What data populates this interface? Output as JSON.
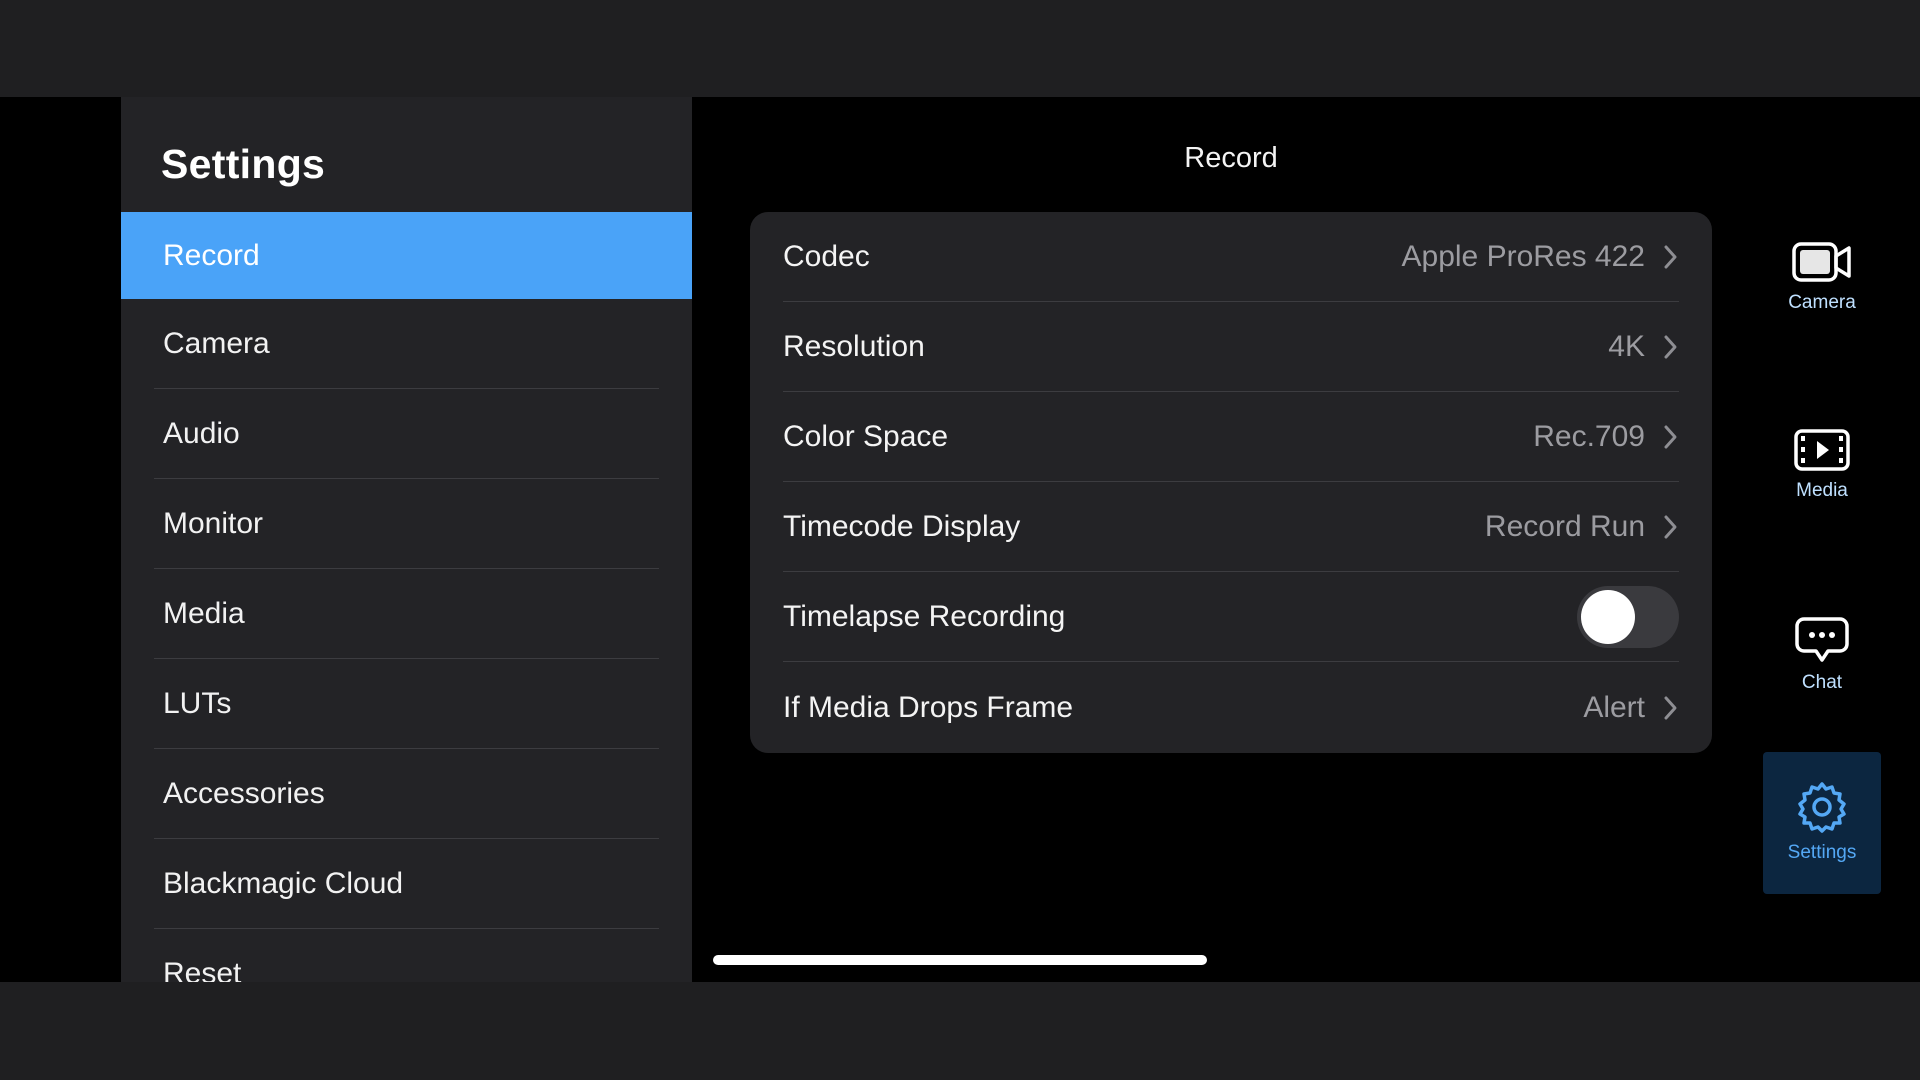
{
  "sidebar": {
    "title": "Settings",
    "items": [
      {
        "label": "Record",
        "active": true
      },
      {
        "label": "Camera"
      },
      {
        "label": "Audio"
      },
      {
        "label": "Monitor"
      },
      {
        "label": "Media"
      },
      {
        "label": "LUTs"
      },
      {
        "label": "Accessories"
      },
      {
        "label": "Blackmagic Cloud"
      },
      {
        "label": "Reset"
      }
    ]
  },
  "main": {
    "title": "Record",
    "rows": [
      {
        "label": "Codec",
        "value": "Apple ProRes 422"
      },
      {
        "label": "Resolution",
        "value": "4K"
      },
      {
        "label": "Color Space",
        "value": "Rec.709"
      },
      {
        "label": "Timecode Display",
        "value": "Record Run"
      },
      {
        "label": "Timelapse Recording",
        "toggle": false
      },
      {
        "label": "If Media Drops Frame",
        "value": "Alert"
      }
    ]
  },
  "tabbar": {
    "tabs": [
      {
        "label": "Camera",
        "icon": "camera-icon"
      },
      {
        "label": "Media",
        "icon": "media-icon"
      },
      {
        "label": "Chat",
        "icon": "chat-icon"
      },
      {
        "label": "Settings",
        "icon": "gear-icon",
        "active": true
      }
    ]
  },
  "colors": {
    "accent": "#4aa3f8",
    "panel": "#232326",
    "background": "#000000",
    "active_tab_bg": "#0c2640",
    "active_tab_text": "#54a8f5"
  }
}
